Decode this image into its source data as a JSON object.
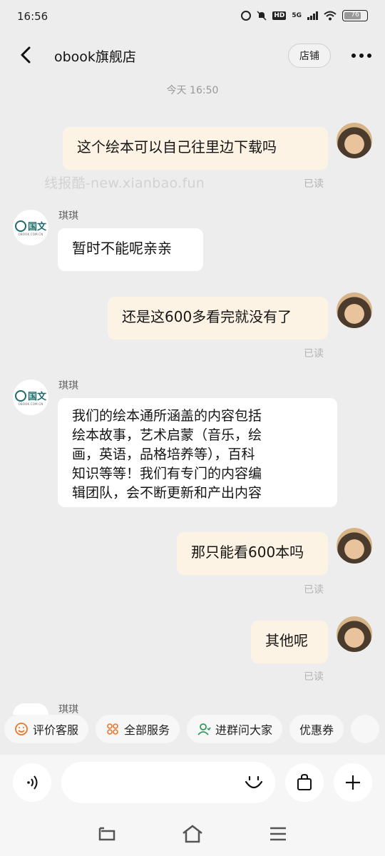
{
  "status_bar": {
    "time": "16:56",
    "network": "5G",
    "hd": "HD",
    "battery": "76",
    "battery_level": 0.76
  },
  "header": {
    "title": "obook旗舰店",
    "shop_button": "店铺"
  },
  "chat": {
    "time_label": "今天 16:50",
    "watermark": "线报酷-new.xianbao.fun",
    "shop_logo_text": "国文",
    "shop_logo_sub": "OBOOK.COM.CN",
    "messages": [
      {
        "from": "user",
        "text": "这个绘本可以自己往里边下载吗",
        "status": "已读"
      },
      {
        "from": "shop",
        "sender": "琪琪",
        "text": "暂时不能呢亲亲"
      },
      {
        "from": "user",
        "text": "还是这600多看完就没有了",
        "status": "已读"
      },
      {
        "from": "shop",
        "sender": "琪琪",
        "lines": [
          "我们的绘本通所涵盖的内容包括",
          "绘本故事，艺术启蒙（音乐，绘",
          "画，英语，品格培养等），百科",
          "知识等等！我们有专门的内容编",
          "辑团队，会不断更新和产出内容"
        ]
      },
      {
        "from": "user",
        "text": "那只能看600本吗",
        "status": "已读"
      },
      {
        "from": "user",
        "text": "其他呢",
        "status": "已读"
      },
      {
        "from": "shop",
        "sender": "琪琪",
        "text": ""
      }
    ]
  },
  "quick_actions": [
    {
      "label": "评价客服",
      "icon": "smile-icon"
    },
    {
      "label": "全部服务",
      "icon": "grid-icon"
    },
    {
      "label": "进群问大家",
      "icon": "group-icon"
    },
    {
      "label": "优惠券",
      "icon": ""
    },
    {
      "label": "",
      "icon": ""
    }
  ],
  "input": {
    "placeholder": ""
  },
  "colors": {
    "background": "#ededed",
    "outgoing_bubble": "#fdf3e4",
    "incoming_bubble": "#ffffff",
    "accent_orange": "#e8762d",
    "accent_green": "#2f9a5a"
  }
}
